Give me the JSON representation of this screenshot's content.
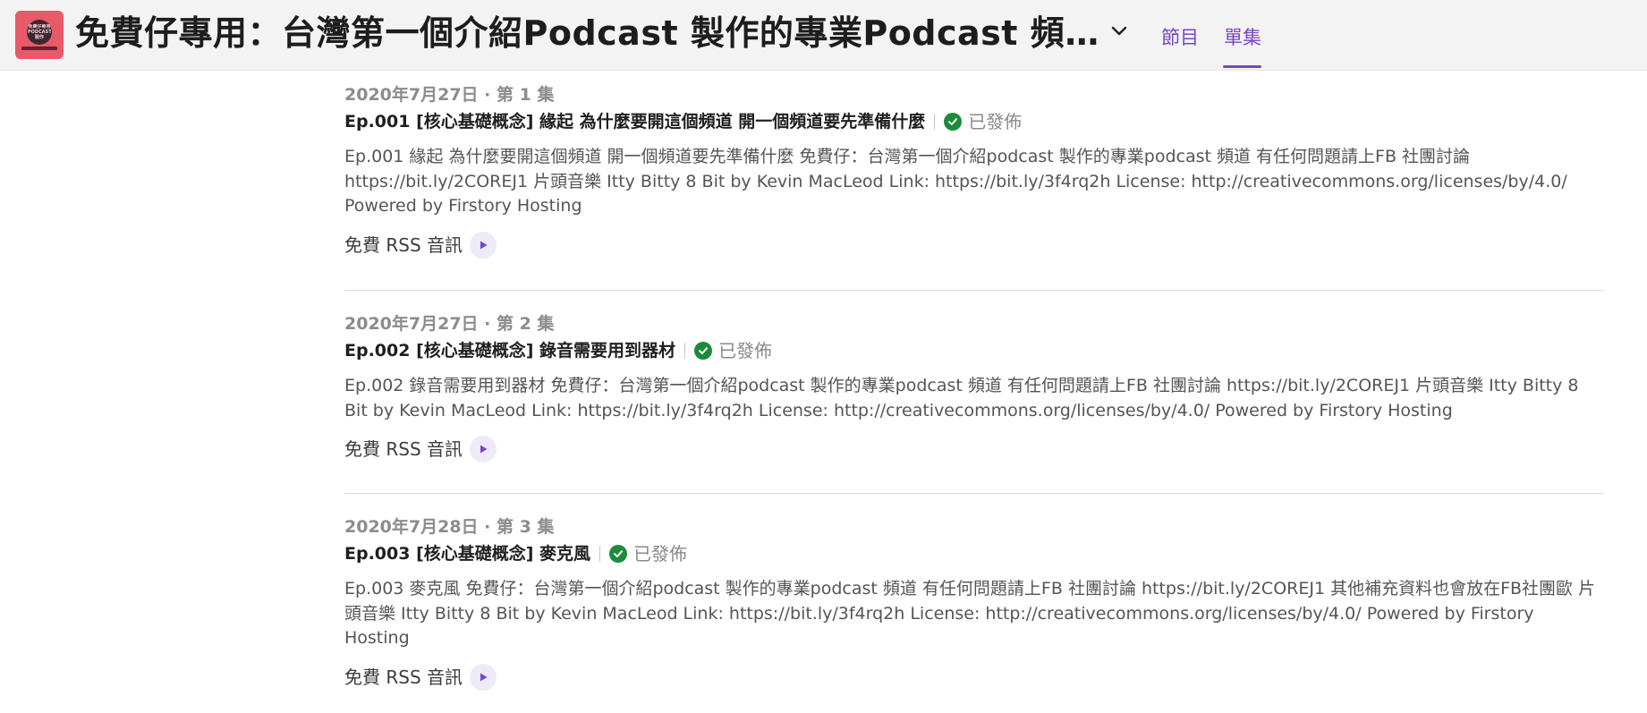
{
  "header": {
    "show_title": "免費仔專用：台灣第一個介紹Podcast 製作的專業Podcast 頻道 有任何問題請上FB 社團討論",
    "cover_text": "免費仔專用 PODCAST 製作",
    "tabs": [
      {
        "label": "節目",
        "active": false
      },
      {
        "label": "單集",
        "active": true
      }
    ],
    "accent_color": "#7a45c9"
  },
  "episodes": [
    {
      "date": "2020年7月27日",
      "number": "第 1 集",
      "dot": "·",
      "title": "Ep.001 [核心基礎概念] 緣起 為什麼要開這個頻道 開一個頻道要先準備什麼",
      "status": "已發佈",
      "description": "Ep.001 緣起 為什麼要開這個頻道 開一個頻道要先準備什麼 免費仔：台灣第一個介紹podcast 製作的專業podcast 頻道 有任何問題請上FB 社團討論 https://bit.ly/2COREJ1 片頭音樂 Itty Bitty 8 Bit by Kevin MacLeod Link: https://bit.ly/3f4rq2h License: http://creativecommons.org/licenses/by/4.0/ Powered by Firstory Hosting",
      "rss_label": "免費 RSS 音訊"
    },
    {
      "date": "2020年7月27日",
      "number": "第 2 集",
      "dot": "·",
      "title": "Ep.002 [核心基礎概念] 錄音需要用到器材",
      "status": "已發佈",
      "description": "Ep.002 錄音需要用到器材 免費仔：台灣第一個介紹podcast 製作的專業podcast 頻道 有任何問題請上FB 社團討論 https://bit.ly/2COREJ1 片頭音樂 Itty Bitty 8 Bit by Kevin MacLeod Link: https://bit.ly/3f4rq2h License: http://creativecommons.org/licenses/by/4.0/ Powered by Firstory Hosting",
      "rss_label": "免費 RSS 音訊"
    },
    {
      "date": "2020年7月28日",
      "number": "第 3 集",
      "dot": "·",
      "title": "Ep.003 [核心基礎概念] 麥克風",
      "status": "已發佈",
      "description": "Ep.003 麥克風 免費仔：台灣第一個介紹podcast 製作的專業podcast 頻道 有任何問題請上FB 社團討論 https://bit.ly/2COREJ1 其他補充資料也會放在FB社團歐 片頭音樂 Itty Bitty 8 Bit by Kevin MacLeod Link: https://bit.ly/3f4rq2h License: http://creativecommons.org/licenses/by/4.0/ Powered by Firstory Hosting",
      "rss_label": "免費 RSS 音訊"
    }
  ],
  "icons": {
    "status": "check-circle-icon",
    "play": "play-icon",
    "dropdown": "chevron-down-icon"
  },
  "status_color": "#1e8a3b"
}
